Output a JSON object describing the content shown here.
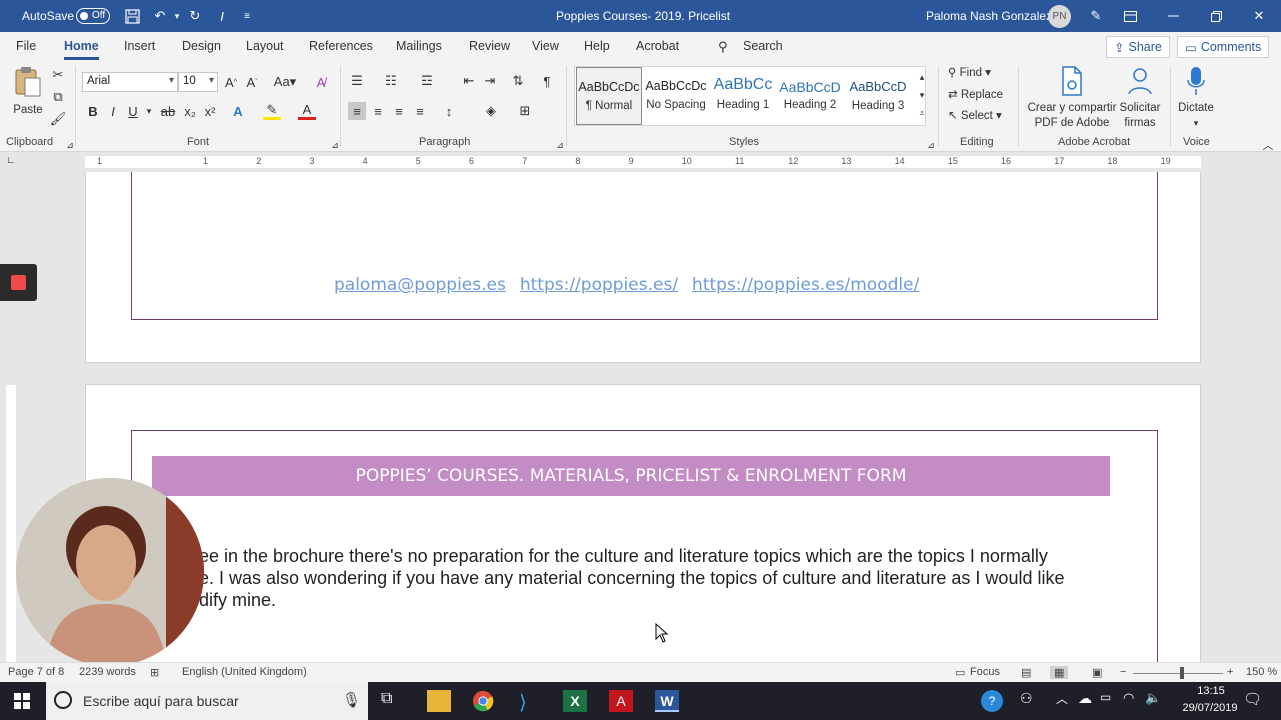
{
  "titlebar": {
    "autosave_label": "AutoSave",
    "autosave_state": "Off",
    "doc_title": "Poppies Courses- 2019. Pricelist",
    "user_name": "Paloma Nash Gonzalez",
    "user_initials": "PN"
  },
  "menu": {
    "tabs": [
      "File",
      "Home",
      "Insert",
      "Design",
      "Layout",
      "References",
      "Mailings",
      "Review",
      "View",
      "Help",
      "Acrobat"
    ],
    "active": "Home",
    "search": "Search",
    "share": "Share",
    "comments": "Comments"
  },
  "ribbon": {
    "clipboard": {
      "paste": "Paste",
      "label": "Clipboard"
    },
    "font": {
      "name": "Arial",
      "size": "10",
      "label": "Font",
      "bold": "B",
      "italic": "I",
      "underline": "U"
    },
    "paragraph": {
      "label": "Paragraph"
    },
    "styles": {
      "label": "Styles",
      "items": [
        {
          "preview": "AaBbCcDc",
          "name": "¶ Normal"
        },
        {
          "preview": "AaBbCcDc",
          "name": "No Spacing"
        },
        {
          "preview": "AaBbCc",
          "name": "Heading 1"
        },
        {
          "preview": "AaBbCcD",
          "name": "Heading 2"
        },
        {
          "preview": "AaBbCcD",
          "name": "Heading 3"
        }
      ]
    },
    "editing": {
      "find": "Find",
      "replace": "Replace",
      "select": "Select",
      "label": "Editing"
    },
    "acrobat": {
      "create_line1": "Crear y compartir",
      "create_line2": "PDF de Adobe",
      "sign_line1": "Solicitar",
      "sign_line2": "firmas",
      "label": "Adobe Acrobat"
    },
    "voice": {
      "dictate": "Dictate",
      "label": "Voice"
    }
  },
  "ruler": {
    "numbers": [
      "1",
      "1",
      "2",
      "3",
      "4",
      "5",
      "6",
      "7",
      "8",
      "9",
      "10",
      "11",
      "12",
      "13",
      "14",
      "15",
      "16",
      "17",
      "18",
      "19"
    ]
  },
  "document": {
    "links": [
      "paloma@poppies.es",
      "https://poppies.es/",
      "https://poppies.es/moodle/"
    ],
    "banner": "POPPIES’ COURSES. MATERIALS, PRICELIST & ENROLMENT FORM",
    "paragraph_lines": [
      "ee in the brochure there's no preparation for the culture and literature topics which are the topics I normally",
      "e. I was also wondering if you have any material concerning the topics of culture and literature as I would like",
      "dify mine."
    ]
  },
  "status": {
    "page": "Page 7 of 8",
    "words": "2239 words",
    "language": "English (United Kingdom)",
    "focus": "Focus",
    "zoom": "150 %"
  },
  "taskbar": {
    "search_placeholder": "Escribe aquí para buscar",
    "time": "13:15",
    "date": "29/07/2019"
  },
  "colors": {
    "word_blue": "#2b579a",
    "banner": "#c48cc4",
    "link": "#6f9bd6",
    "frame": "#7a3b6b"
  }
}
